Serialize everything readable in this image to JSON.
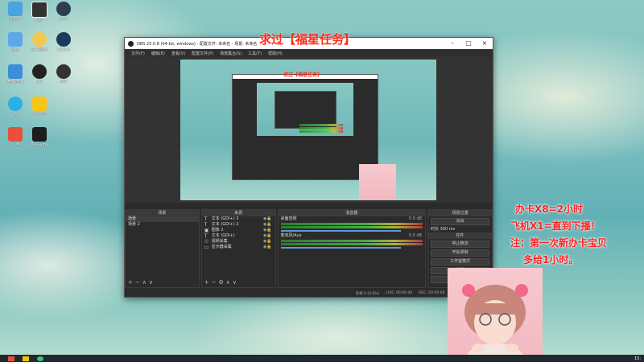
{
  "desktop": {
    "icons": [
      {
        "label": "此电脑",
        "color": "#4aa3e0"
      },
      {
        "label": "控制面板",
        "color": "#f2c94c"
      },
      {
        "label": "网络",
        "color": "#5fa8e8"
      },
      {
        "label": "QQ",
        "color": "#222222"
      },
      {
        "label": "宽带连接",
        "color": "#3b8fd8"
      },
      {
        "label": "IE",
        "color": "#2bb0e6"
      },
      {
        "label": "应用",
        "color": "#e8503a"
      },
      {
        "label": "软件",
        "color": "#333333"
      },
      {
        "label": "OBS",
        "color": "#2c3e50"
      },
      {
        "label": "Steam",
        "color": "#1b3a5c"
      },
      {
        "label": "QQ音乐",
        "color": "#f5c518"
      },
      {
        "label": "WeGame",
        "color": "#1d1d1d"
      }
    ]
  },
  "obs": {
    "title": "OBS 25.0.8 (64-bit, windows) - 配置文件: 未命名 - 场景: 未命名",
    "menu": [
      "文件(F)",
      "编辑(E)",
      "查看(V)",
      "配置文件(P)",
      "场景集合(S)",
      "工具(T)",
      "帮助(H)"
    ],
    "nested_banner": "求过【福星任务】",
    "docks": {
      "scenes": {
        "header": "场景",
        "items": [
          "场景",
          "场景 2"
        ]
      },
      "sources": {
        "header": "来源",
        "items": [
          {
            "icon": "T",
            "label": "文本 (GDI+) 3"
          },
          {
            "icon": "T",
            "label": "文本 (GDI+) 2"
          },
          {
            "icon": "▣",
            "label": "图像 2"
          },
          {
            "icon": "T",
            "label": "文本 (GDI+)"
          },
          {
            "icon": "☉",
            "label": "视频采集"
          },
          {
            "icon": "▭",
            "label": "显示器采集"
          }
        ]
      },
      "mixer": {
        "header": "混音器",
        "channels": [
          {
            "name": "桌面音频",
            "db": "0.0 dB"
          },
          {
            "name": "麦克风/Aux",
            "db": "0.0 dB"
          }
        ]
      },
      "transitions": {
        "header": "场景过渡",
        "mode": "淡出",
        "duration_label": "时长",
        "duration": "300 ms"
      },
      "controls": {
        "header": "控件",
        "buttons": [
          "停止推流",
          "开始录制",
          "工作室模式",
          "设置",
          "退出"
        ]
      }
    },
    "status": {
      "dropped": "丢帧 0 (0.0%)",
      "live": "LIVE: 00:00:00",
      "rec": "REC: 00:00:00",
      "cpu": "CPU: 3.0%, 30.00 fps"
    }
  },
  "overlay": {
    "banner": "求过【福星任务】",
    "promo_lines": [
      "办卡X8=2小时",
      "飞机X1=直到下播！",
      "注：第一次新办卡宝贝",
      "多给1小时。"
    ]
  },
  "taskbar": {
    "clock": "15:"
  }
}
